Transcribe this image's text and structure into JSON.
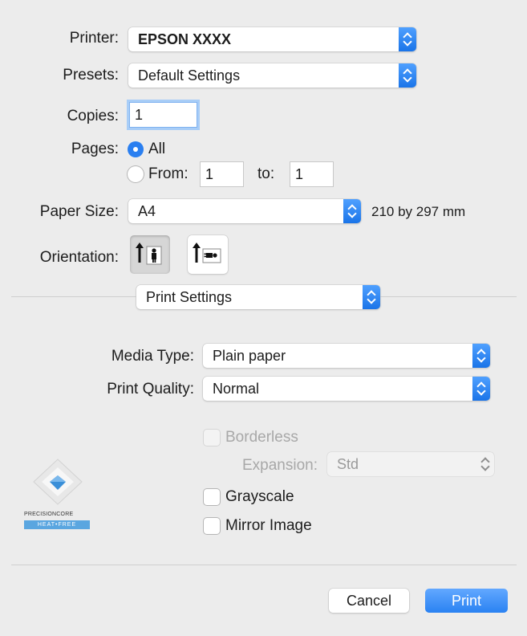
{
  "printer": {
    "label": "Printer:",
    "value": "EPSON XXXX"
  },
  "presets": {
    "label": "Presets:",
    "value": "Default Settings"
  },
  "copies": {
    "label": "Copies:",
    "value": "1"
  },
  "pages": {
    "label": "Pages:",
    "all_label": "All",
    "from_label": "From:",
    "from_value": "1",
    "to_label": "to:",
    "to_value": "1"
  },
  "paper_size": {
    "label": "Paper Size:",
    "value": "A4",
    "dimensions": "210 by 297 mm"
  },
  "orientation": {
    "label": "Orientation:",
    "selected": "portrait",
    "options": [
      "portrait-icon",
      "landscape-icon"
    ]
  },
  "section": {
    "value": "Print Settings"
  },
  "media_type": {
    "label": "Media Type:",
    "value": "Plain paper"
  },
  "print_quality": {
    "label": "Print Quality:",
    "value": "Normal"
  },
  "borderless": {
    "label": "Borderless",
    "checked": false,
    "enabled": false
  },
  "expansion": {
    "label": "Expansion:",
    "value": "Std",
    "enabled": false
  },
  "grayscale": {
    "label": "Grayscale",
    "checked": false
  },
  "mirror_image": {
    "label": "Mirror Image",
    "checked": false
  },
  "logo": {
    "line1": "PRECISIONCORE",
    "line2": "HEAT•FREE"
  },
  "buttons": {
    "cancel": "Cancel",
    "print": "Print"
  },
  "colors": {
    "accent": "#2a7ff0",
    "background": "#ececec"
  }
}
